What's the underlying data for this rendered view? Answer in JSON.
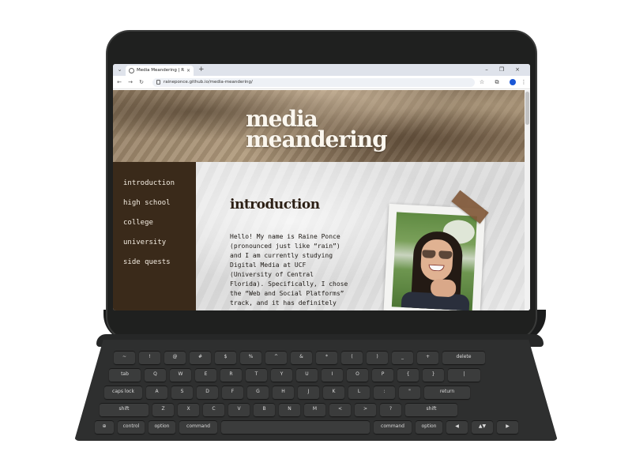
{
  "browser": {
    "tab_dropdown": "⌄",
    "tab_title": "Media Meandering | Raine Po...",
    "tab_close": "×",
    "new_tab": "+",
    "window_minimize": "–",
    "window_restore": "❐",
    "window_close": "×",
    "back": "←",
    "forward": "→",
    "reload": "↻",
    "site_settings": "⊜",
    "url": "raineponce.github.io/media-meandering/",
    "bookmark": "☆",
    "extensions": "⧉",
    "menu": "⋮"
  },
  "site": {
    "title_line1": "media",
    "title_line2": "meandering"
  },
  "nav": {
    "items": [
      "introduction",
      "high school",
      "college",
      "university",
      "side quests"
    ]
  },
  "content": {
    "heading": "introduction",
    "paragraph_lines": [
      "Hello! My name is Raine Ponce",
      "(pronounced just like “rain”)",
      "and I am currently studying",
      "Digital Media at UCF",
      "(University of Central",
      "Florida). Specifically, I chose",
      "the “Web and Social Platforms”",
      "track, and it has definitely"
    ]
  },
  "keyboard": {
    "row1": [
      "~",
      "!",
      "@",
      "#",
      "$",
      "%",
      "^",
      "&",
      "*",
      "(",
      ")",
      "_",
      "+",
      "delete"
    ],
    "row2": [
      "tab",
      "Q",
      "W",
      "E",
      "R",
      "T",
      "Y",
      "U",
      "I",
      "O",
      "P",
      "{",
      "}",
      "|"
    ],
    "row3": [
      "caps lock",
      "A",
      "S",
      "D",
      "F",
      "G",
      "H",
      "J",
      "K",
      "L",
      ":",
      "\"",
      "return"
    ],
    "row4": [
      "shift",
      "Z",
      "X",
      "C",
      "V",
      "B",
      "N",
      "M",
      "<",
      ">",
      "?",
      "shift"
    ],
    "row5": [
      "globe",
      "control",
      "option",
      "command",
      "",
      "command",
      "option",
      "◀",
      "▲▼",
      "▶"
    ]
  }
}
